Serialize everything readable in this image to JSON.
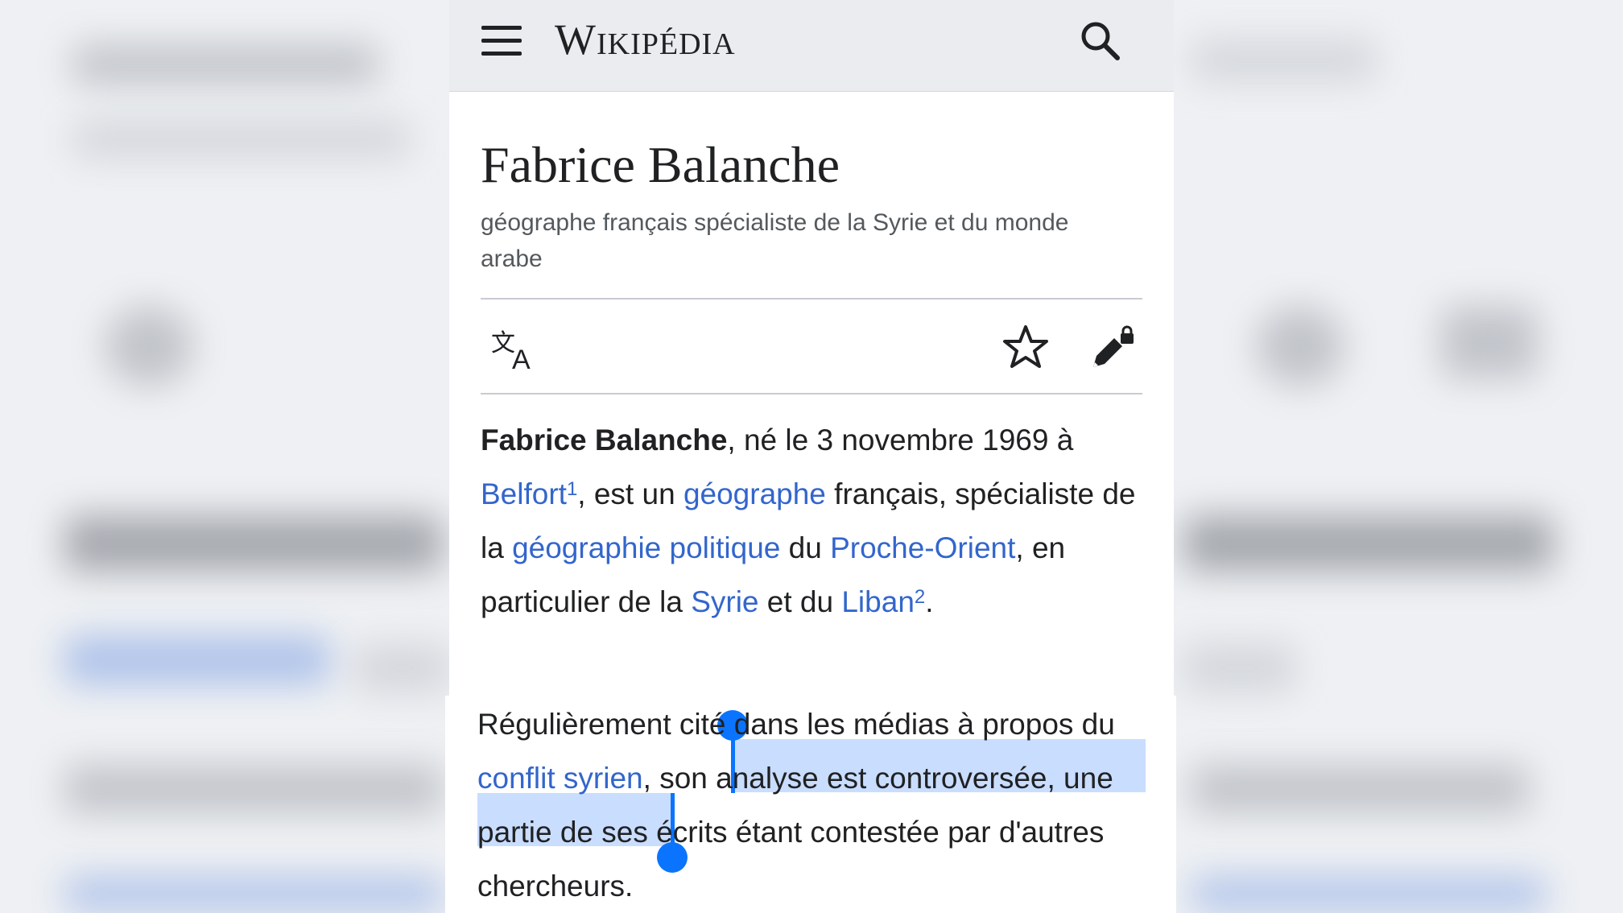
{
  "header": {
    "brand": "Wikipédia",
    "menu_icon": "hamburger-menu-icon",
    "search_icon": "search-icon"
  },
  "article": {
    "title": "Fabrice Balanche",
    "subtitle": "géographe français spécialiste de la Syrie et du monde arabe"
  },
  "actions": {
    "language_icon": "language-translate-icon",
    "watch_icon": "star-icon",
    "edit_icon": "locked-edit-icon"
  },
  "intro": {
    "bold_name": "Fabrice Balanche",
    "t1": ", né le 3 novembre 1969 à ",
    "link_belfort": "Belfort",
    "ref1": "1",
    "t2": ", est un ",
    "link_geographe": "géographe",
    "t3": " français, spécialiste de la ",
    "link_geo_politique": "géographie politique",
    "t4": " du ",
    "link_proche_orient": "Proche-Orient",
    "t5": ", en particulier de la ",
    "link_syrie": "Syrie",
    "t6": " et du ",
    "link_liban": "Liban",
    "ref2": "2",
    "t7": "."
  },
  "second": {
    "t1": "Régulièrement cité dans les médias à propos du ",
    "link_conflit": "conflit syrien",
    "t2": ", ",
    "selected": "son analyse est controversée",
    "t3": ", une partie de ses écrits étant contestée par d'autres chercheurs."
  },
  "colors": {
    "link": "#3366cc",
    "selection": "#c9ddff",
    "handle": "#0a74ff",
    "topbar": "#eaecf0"
  }
}
